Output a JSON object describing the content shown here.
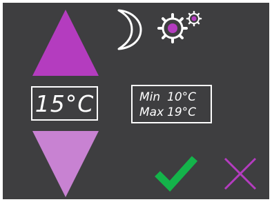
{
  "screen": {
    "background": "#3e3e40"
  },
  "controls": {
    "increase_icon": "triangle-up",
    "decrease_icon": "triangle-down",
    "up_color": "#b43cbf",
    "down_color": "#c882d2"
  },
  "current_temperature": {
    "value": "15°C"
  },
  "range": {
    "min_label": "Min",
    "min_value": "10°C",
    "max_label": "Max",
    "max_value": "19°C"
  },
  "toolbar": {
    "night_mode_icon": "crescent-moon",
    "settings_icon": "gears",
    "confirm_icon": "checkmark",
    "cancel_icon": "x-mark",
    "confirm_color": "#14b34a",
    "cancel_color": "#b43cbf"
  }
}
